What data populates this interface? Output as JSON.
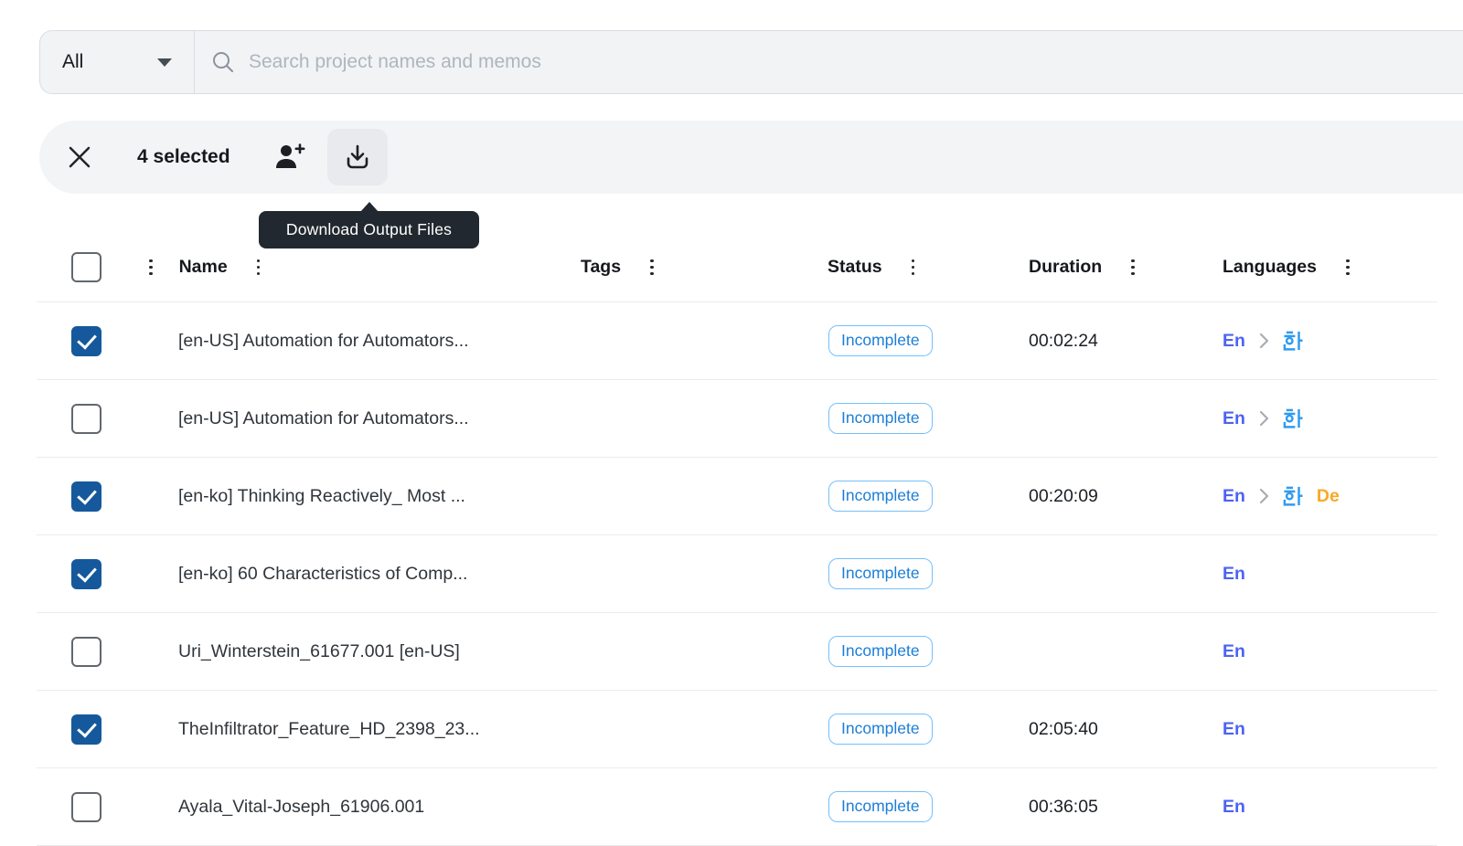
{
  "search": {
    "filter_label": "All",
    "placeholder": "Search project names and memos"
  },
  "toolbar": {
    "selected_count_label": "4 selected",
    "tooltip": "Download Output Files"
  },
  "table": {
    "headers": {
      "name": "Name",
      "tags": "Tags",
      "status": "Status",
      "duration": "Duration",
      "languages": "Languages"
    },
    "rows": [
      {
        "checked": true,
        "name": "[en-US] Automation for Automators...",
        "tags": "",
        "status": "Incomplete",
        "duration": "00:02:24",
        "languages": [
          {
            "text": "En",
            "color": "#4c63f3"
          },
          {
            "icon": "chevron-right",
            "color": "#a6adb5"
          },
          {
            "icon": "hangul-ko",
            "glyph": "한",
            "color": "#2f9bf0"
          }
        ]
      },
      {
        "checked": false,
        "name": "[en-US] Automation for Automators...",
        "tags": "",
        "status": "Incomplete",
        "duration": "",
        "languages": [
          {
            "text": "En",
            "color": "#4c63f3"
          },
          {
            "icon": "chevron-right",
            "color": "#a6adb5"
          },
          {
            "icon": "hangul-ko",
            "glyph": "한",
            "color": "#2f9bf0"
          }
        ]
      },
      {
        "checked": true,
        "name": "[en-ko] Thinking Reactively_ Most ...",
        "tags": "",
        "status": "Incomplete",
        "duration": "00:20:09",
        "languages": [
          {
            "text": "En",
            "color": "#4c63f3"
          },
          {
            "icon": "chevron-right",
            "color": "#a6adb5"
          },
          {
            "icon": "hangul-ko",
            "glyph": "한",
            "color": "#2f9bf0"
          },
          {
            "text": "De",
            "color": "#f9a825"
          }
        ]
      },
      {
        "checked": true,
        "name": "[en-ko] 60 Characteristics of Comp...",
        "tags": "",
        "status": "Incomplete",
        "duration": "",
        "languages": [
          {
            "text": "En",
            "color": "#4c63f3"
          }
        ]
      },
      {
        "checked": false,
        "name": "Uri_Winterstein_61677.001 [en-US]",
        "tags": "",
        "status": "Incomplete",
        "duration": "",
        "languages": [
          {
            "text": "En",
            "color": "#4c63f3"
          }
        ]
      },
      {
        "checked": true,
        "name": "TheInfiltrator_Feature_HD_2398_23...",
        "tags": "",
        "status": "Incomplete",
        "duration": "02:05:40",
        "languages": [
          {
            "text": "En",
            "color": "#4c63f3"
          }
        ]
      },
      {
        "checked": false,
        "name": "Ayala_Vital-Joseph_61906.001",
        "tags": "",
        "status": "Incomplete",
        "duration": "00:36:05",
        "languages": [
          {
            "text": "En",
            "color": "#4c63f3"
          }
        ]
      }
    ]
  },
  "colors": {
    "checkbox_checked": "#15599c",
    "status_text": "#1c7ed6",
    "status_border": "#74c0fc",
    "lang_en": "#4c63f3",
    "lang_ko": "#2f9bf0",
    "lang_de": "#f9a825",
    "tooltip_bg": "#222830",
    "toolbar_bg": "#f3f4f6",
    "searchbar_bg": "#f1f3f5"
  }
}
